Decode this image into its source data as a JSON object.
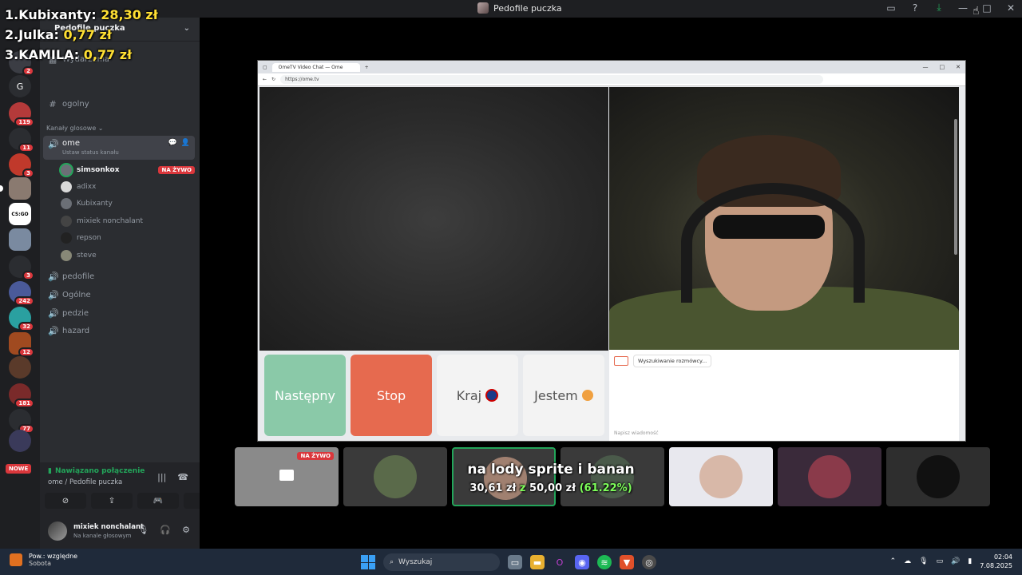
{
  "window": {
    "title": "Pedofile puczka"
  },
  "goals": [
    {
      "rank": "1.",
      "name": "Kubixanty:",
      "amount": "28,30 zł"
    },
    {
      "rank": "2.",
      "name": "Julka:",
      "amount": "0,77 zł"
    },
    {
      "rank": "3.",
      "name": "KAMILA:",
      "amount": "0,77 zł"
    }
  ],
  "server": {
    "name": "Pedofile puczka",
    "events": "Wydarzenia",
    "text_channel": "ogolny",
    "voice_category": "Kanały glosowe",
    "active_channel": {
      "name": "ome",
      "status": "Ustaw status kanału"
    },
    "live_label": "NA ŻYWO",
    "members": [
      "simsonkox",
      "adixx",
      "Kubixanty",
      "mixiek nonchalant",
      "repson",
      "steve"
    ],
    "other_channels": [
      "pedofile",
      "Ogólne",
      "pedzie",
      "hazard"
    ]
  },
  "guild_badges": [
    "2",
    "119",
    "11",
    "3",
    "3",
    "242",
    "32",
    "12",
    "181",
    "77"
  ],
  "guild_letter": "G",
  "guild_csgo": "CS:GO",
  "nowe_label": "NOWE",
  "voice": {
    "status": "Nawiązano połączenie",
    "location": "ome / Pedofile puczka"
  },
  "user": {
    "name": "mixiek nonchalant",
    "sub": "Na kanale głosowym"
  },
  "browser": {
    "tab_title": "OmeTV Video Chat — Ome",
    "url": "https://ome.tv",
    "buttons": {
      "next": "Następny",
      "stop": "Stop",
      "country": "Kraj",
      "gender": "Jestem"
    },
    "chat_status": "Wyszukiwanie rozmówcy...",
    "chat_placeholder": "Napisz wiadomość"
  },
  "thumbnails": {
    "live_label": "NA ŻYWO"
  },
  "donation": {
    "title": "na lody sprite i banan",
    "current": "30,61 zł",
    "sep": "z",
    "target": "50,00 zł",
    "percent": "(61.22%)"
  },
  "taskbar": {
    "weather_title": "Pow.: względne",
    "weather_sub": "Sobota",
    "search": "Wyszukaj",
    "time": "02:04",
    "date": "7.08.2025"
  }
}
